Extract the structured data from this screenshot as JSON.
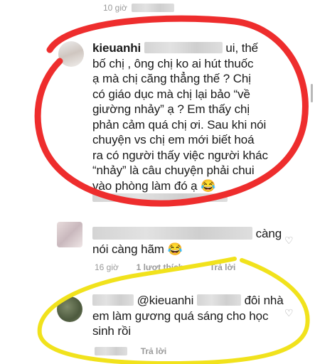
{
  "top": {
    "time_fragment": "10 giờ"
  },
  "comment1": {
    "username": "kieuanhi",
    "line1_tail": "ui, thế",
    "lines": [
      "bố chị , ông chị ko ai hút thuốc",
      "ạ mà chị căng thẳng thế ? Chị",
      "có giáo dục mà chị lại bảo “về",
      "giường nhảy” ạ ? Em thấy chị",
      "phản cảm quá chị ơi. Sau khi nói",
      "chuyện vs chị em mới biết hoá",
      "ra có người thấy việc người khác",
      "“nhảy” là câu chuyện phải chui",
      "vào phòng làm đó ạ 😂"
    ]
  },
  "comment2": {
    "line1_tail": "càng",
    "line2": "nói càng hãm 😂",
    "time": "16 giờ",
    "likes": "1 lượt thích",
    "reply": "Trả lời"
  },
  "comment3": {
    "mention": "@kieuanhi",
    "line1_tail": "đôi nhà",
    "line2": "em làm gương quá sáng cho học",
    "line3": "sinh rồi",
    "reply": "Trả lời"
  },
  "icons": {
    "heart": "heart-icon"
  },
  "colors": {
    "red_circle": "#ee2d2d",
    "yellow_circle": "#f1e21c",
    "meta": "#9a9a9a"
  }
}
